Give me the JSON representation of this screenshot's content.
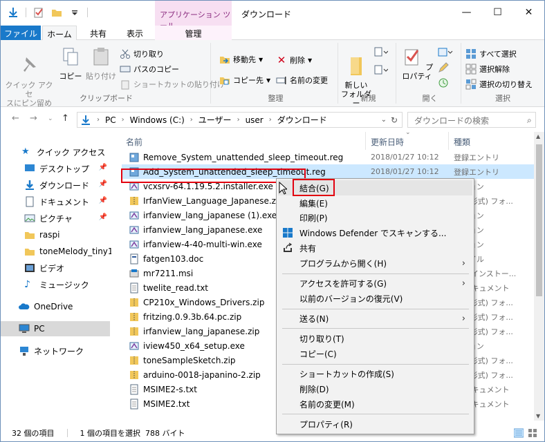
{
  "window": {
    "title": "ダウンロード",
    "context_tab_header": "アプリケーション ツール",
    "minimize": "—",
    "maximize": "☐",
    "close": "✕"
  },
  "ribbon_tabs": {
    "file": "ファイル",
    "home": "ホーム",
    "share": "共有",
    "view": "表示",
    "manage": "管理"
  },
  "ribbon": {
    "clipboard": {
      "label": "クリップボード",
      "pin": "クイック アクセ\nスにピン留め",
      "copy": "コピー",
      "paste": "貼り付け",
      "cut": "切り取り",
      "copy_path": "パスのコピー",
      "paste_shortcut": "ショートカットの貼り付け"
    },
    "organize": {
      "label": "整理",
      "move_to": "移動先",
      "copy_to": "コピー先",
      "delete": "削除",
      "rename": "名前の変更"
    },
    "new": {
      "label": "新規",
      "new_folder": "新しい\nフォルダー"
    },
    "open": {
      "label": "開く",
      "properties": "プロパティ"
    },
    "select": {
      "label": "選択",
      "select_all": "すべて選択",
      "select_none": "選択解除",
      "invert": "選択の切り替え"
    }
  },
  "address": {
    "crumbs": [
      "PC",
      "Windows (C:)",
      "ユーザー",
      "user",
      "ダウンロード"
    ],
    "search_placeholder": "ダウンロードの検索"
  },
  "nav": {
    "items": [
      {
        "label": "クイック アクセス"
      },
      {
        "label": "デスクトップ"
      },
      {
        "label": "ダウンロード"
      },
      {
        "label": "ドキュメント"
      },
      {
        "label": "ピクチャ"
      },
      {
        "label": "raspi"
      },
      {
        "label": "toneMelody_tiny13a"
      },
      {
        "label": "ビデオ"
      },
      {
        "label": "ミュージック"
      },
      {
        "label": "OneDrive"
      },
      {
        "label": "PC"
      },
      {
        "label": "ネットワーク"
      }
    ]
  },
  "list": {
    "headers": {
      "name": "名前",
      "date": "更新日時",
      "type": "種類"
    },
    "rows": [
      {
        "name": "Remove_System_unattended_sleep_timeout.reg",
        "date": "2018/01/27 10:12",
        "type": "登録エントリ"
      },
      {
        "name": "Add_System_unattended_sleep_timeout.reg",
        "date": "2018/01/27 10:12",
        "type": "登録エントリ"
      },
      {
        "name": "vcxsrv-64.1.19.5.2.installer.exe",
        "date": "",
        "type": "ーション"
      },
      {
        "name": "IrfanView_Language_Japanese.zip",
        "date": "",
        "type": "(zip 形式) フォ..."
      },
      {
        "name": "irfanview_lang_japanese (1).exe",
        "date": "",
        "type": "ーション"
      },
      {
        "name": "irfanview_lang_japanese.exe",
        "date": "",
        "type": "ーション"
      },
      {
        "name": "irfanview-4-40-multi-win.exe",
        "date": "",
        "type": "ーション"
      },
      {
        "name": "fatgen103.doc",
        "date": "",
        "type": "ファイル"
      },
      {
        "name": "mr7211.msi",
        "date": "",
        "type": "ows インストー..."
      },
      {
        "name": "twelite_read.txt",
        "date": "",
        "type": "ト ドキュメント"
      },
      {
        "name": "CP210x_Windows_Drivers.zip",
        "date": "",
        "type": "(zip 形式) フォ..."
      },
      {
        "name": "fritzing.0.9.3b.64.pc.zip",
        "date": "",
        "type": "(zip 形式) フォ..."
      },
      {
        "name": "irfanview_lang_japanese.zip",
        "date": "",
        "type": "(zip 形式) フォ..."
      },
      {
        "name": "iview450_x64_setup.exe",
        "date": "",
        "type": "ーション"
      },
      {
        "name": "toneSampleSketch.zip",
        "date": "",
        "type": "(zip 形式) フォ..."
      },
      {
        "name": "arduino-0018-japanino-2.zip",
        "date": "",
        "type": "(zip 形式) フォ..."
      },
      {
        "name": "MSIME2-s.txt",
        "date": "",
        "type": "ト ドキュメント"
      },
      {
        "name": "MSIME2.txt",
        "date": "",
        "type": "ト ドキュメント"
      }
    ]
  },
  "status": {
    "count": "32 個の項目",
    "selection": "1 個の項目を選択  788 バイト"
  },
  "context_menu": {
    "merge": "結合(G)",
    "edit": "編集(E)",
    "print": "印刷(P)",
    "defender": "Windows Defender でスキャンする...",
    "share": "共有",
    "open_with": "プログラムから開く(H)",
    "give_access": "アクセスを許可する(G)",
    "restore": "以前のバージョンの復元(V)",
    "send_to": "送る(N)",
    "cut": "切り取り(T)",
    "copy": "コピー(C)",
    "create_shortcut": "ショートカットの作成(S)",
    "delete": "削除(D)",
    "rename": "名前の変更(M)",
    "properties": "プロパティ(R)"
  },
  "colors": {
    "accent": "#1979ca",
    "highlight_box": "#e2000f",
    "context_tab": "#f7dff2"
  }
}
